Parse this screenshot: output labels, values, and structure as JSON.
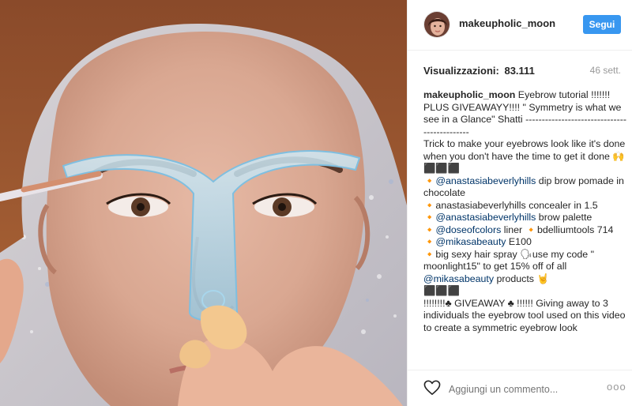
{
  "post": {
    "username": "makeupholic_moon",
    "follow_label": "Segui",
    "views_label": "Visualizzazioni:",
    "views_count": "83.111",
    "time_ago": "46 sett."
  },
  "caption": {
    "username": "makeupholic_moon",
    "line1": " Eyebrow tutorial !!!!!!! PLUS GIVEAWAYY!!!! \" Symmetry is what we see in a Glance\" Shatti ---------------------------------------------",
    "line2": "Trick to make your eyebrows look like it's done when you don't have the time to get it done 🙌",
    "line3": "⬛⬛⬛",
    "m1": "@anastasiabeverlyhills",
    "t1": " dip brow pomade in chocolate",
    "t2": "🔸anastasiabeverlyhills concealer in 1.5",
    "m2": "@anastasiabeverlyhills",
    "t3": " brow palette",
    "m3": "@doseofcolors",
    "t4": " liner 🔸bdelliumtools 714 🔸",
    "m4": "@mikasabeauty",
    "t5": " E100",
    "t6": "🔸big sexy hair spray 🗣use my code \" moonlight15\" to get 15% off of all ",
    "m5": "@mikasabeauty",
    "t7": " products 🤘",
    "line4": "⬛⬛⬛",
    "line5": "!!!!!!!!♣ GIVEAWAY ♣ !!!!!! Giving away to 3 individuals the eyebrow tool used on this video to create a symmetric eyebrow look"
  },
  "footer": {
    "comment_placeholder": "Aggiungi un commento...",
    "more_label": "ooo"
  },
  "colors": {
    "accent": "#3897f0",
    "mention": "#003569",
    "muted": "#999999"
  },
  "icons": {
    "like": "heart-icon",
    "more": "more-options-icon"
  }
}
